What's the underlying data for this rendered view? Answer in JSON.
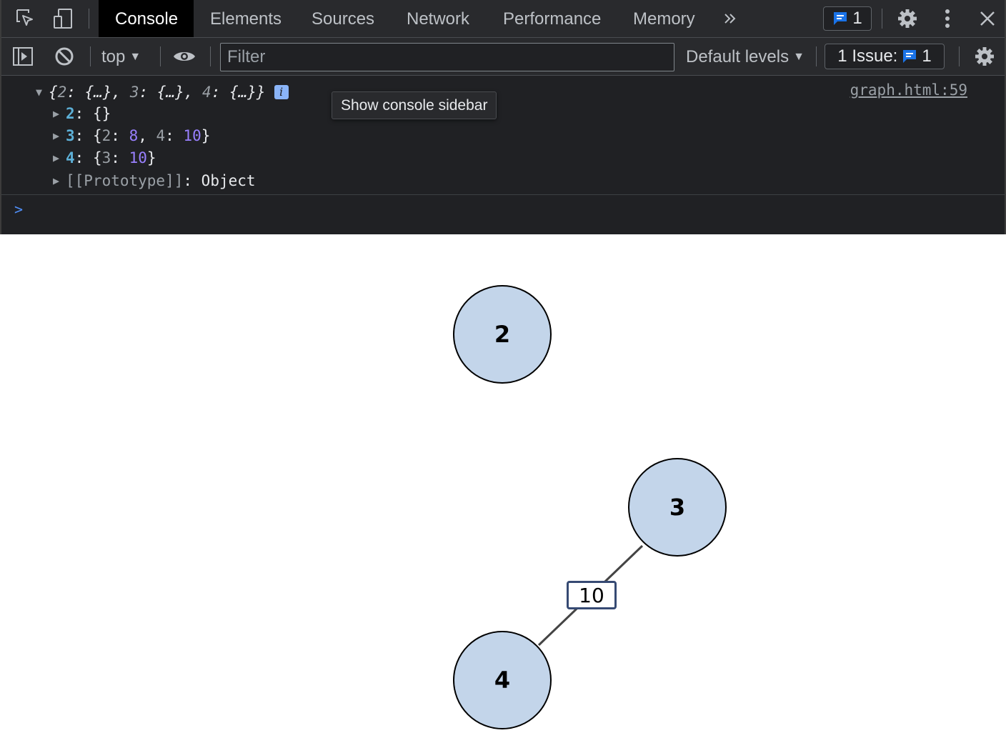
{
  "devtools": {
    "tabs": [
      "Console",
      "Elements",
      "Sources",
      "Network",
      "Performance",
      "Memory"
    ],
    "active_tab": "Console",
    "messages_badge_count": "1",
    "toolbar": {
      "context": "top",
      "filter_placeholder": "Filter",
      "levels": "Default levels",
      "issues_label": "1 Issue:",
      "issues_count": "1"
    },
    "tooltip": "Show console sidebar",
    "console": {
      "source_link": "graph.html:59",
      "summary": {
        "open": "{",
        "k1": "2",
        "v1": "{…}",
        "k2": "3",
        "v2": "{…}",
        "k3": "4",
        "v3": "{…}",
        "close": "}"
      },
      "entries": [
        {
          "key": "2",
          "parts": [
            {
              "t": "{}",
              "c": ""
            }
          ]
        },
        {
          "key": "3",
          "parts": [
            {
              "t": "{",
              "c": ""
            },
            {
              "t": "2",
              "c": "kd"
            },
            {
              "t": ": ",
              "c": ""
            },
            {
              "t": "8",
              "c": "n"
            },
            {
              "t": ", ",
              "c": ""
            },
            {
              "t": "4",
              "c": "kd"
            },
            {
              "t": ": ",
              "c": ""
            },
            {
              "t": "10",
              "c": "n"
            },
            {
              "t": "}",
              "c": ""
            }
          ]
        },
        {
          "key": "4",
          "parts": [
            {
              "t": "{",
              "c": ""
            },
            {
              "t": "3",
              "c": "kd"
            },
            {
              "t": ": ",
              "c": ""
            },
            {
              "t": "10",
              "c": "n"
            },
            {
              "t": "}",
              "c": ""
            }
          ]
        }
      ],
      "prototype_label": "[[Prototype]]",
      "prototype_value": "Object"
    }
  },
  "graph": {
    "nodes": [
      {
        "id": "2"
      },
      {
        "id": "3"
      },
      {
        "id": "4"
      }
    ],
    "edges": [
      {
        "from": "3",
        "to": "4",
        "weight": "10"
      }
    ]
  },
  "colors": {
    "node_fill": "#c3d5ea",
    "edge_label_border": "#364a73",
    "devtools_bg": "#202124",
    "accent_blue": "#1a73e8"
  }
}
